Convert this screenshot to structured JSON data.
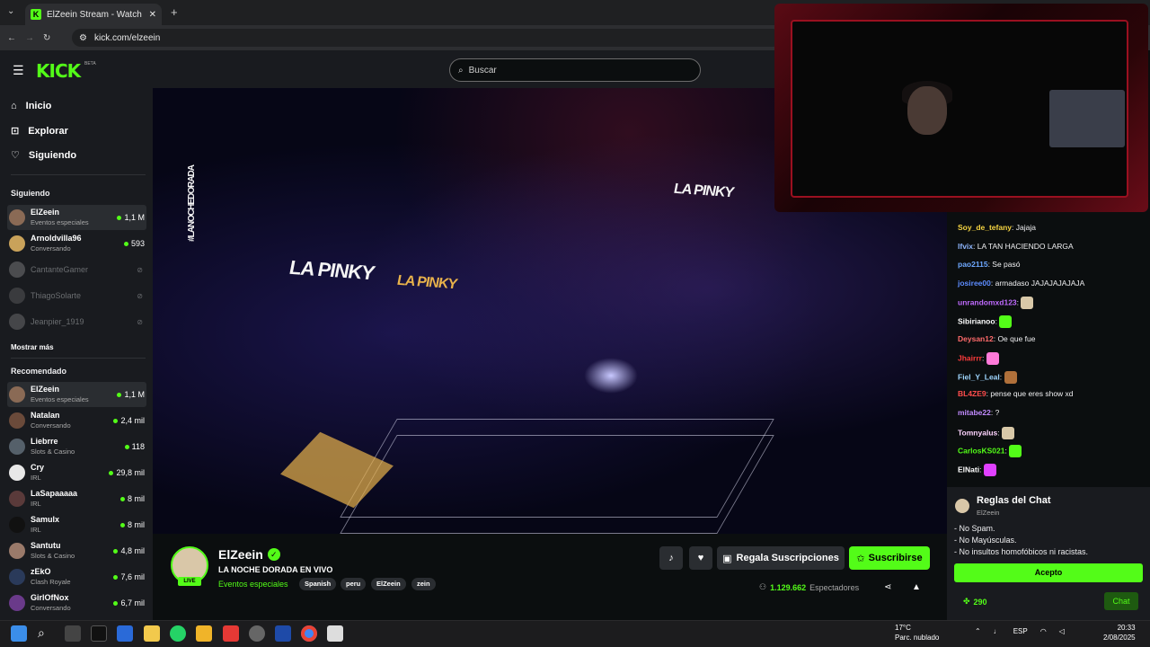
{
  "browser": {
    "tab_title": "ElZeein Stream - Watch Live",
    "url": "kick.com/elzeein"
  },
  "header": {
    "logo": "KICK",
    "beta": "BETA",
    "search_placeholder": "Buscar"
  },
  "sidebar": {
    "nav": [
      {
        "label": "Inicio",
        "icon": "home-icon"
      },
      {
        "label": "Explorar",
        "icon": "compass-icon"
      },
      {
        "label": "Siguiendo",
        "icon": "heart-icon"
      }
    ],
    "following_title": "Siguiendo",
    "following": [
      {
        "name": "ElZeein",
        "category": "Eventos especiales",
        "viewers": "1,1 M",
        "live": true
      },
      {
        "name": "Arnoldvilla96",
        "category": "Conversando",
        "viewers": "593",
        "live": true
      },
      {
        "name": "CantanteGamer",
        "category": "",
        "viewers": "",
        "live": false
      },
      {
        "name": "ThiagoSolarte",
        "category": "",
        "viewers": "",
        "live": false
      },
      {
        "name": "Jeanpier_1919",
        "category": "",
        "viewers": "",
        "live": false
      }
    ],
    "show_more": "Mostrar más",
    "recommended_title": "Recomendado",
    "recommended": [
      {
        "name": "ElZeein",
        "category": "Eventos especiales",
        "viewers": "1,1 M"
      },
      {
        "name": "Natalan",
        "category": "Conversando",
        "viewers": "2,4 mil"
      },
      {
        "name": "Liebrre",
        "category": "Slots & Casino",
        "viewers": "118"
      },
      {
        "name": "Cry",
        "category": "IRL",
        "viewers": "29,8 mil"
      },
      {
        "name": "LaSapaaaaa",
        "category": "IRL",
        "viewers": "8 mil"
      },
      {
        "name": "Samulx",
        "category": "IRL",
        "viewers": "8 mil"
      },
      {
        "name": "Santutu",
        "category": "Slots & Casino",
        "viewers": "4,8 mil"
      },
      {
        "name": "zEkO",
        "category": "Clash Royale",
        "viewers": "7,6 mil"
      },
      {
        "name": "GirlOfNox",
        "category": "Conversando",
        "viewers": "6,7 mil"
      }
    ]
  },
  "video": {
    "signs": [
      "LA PINKY",
      "LA PINKY",
      "LA PINKY",
      "#LANOCHEDORADA"
    ]
  },
  "stream": {
    "name": "ElZeein",
    "live_label": "LIVE",
    "title": "LA NOCHE DORADA EN VIVO",
    "category": "Eventos especiales",
    "tags": [
      "Spanish",
      "peru",
      "ElZeein",
      "zein"
    ],
    "gift_label": "Regala Suscripciones",
    "subscribe_label": "Suscribirse",
    "viewers_count": "1.129.662",
    "viewers_label": "Espectadores"
  },
  "chat": {
    "messages": [
      {
        "user": "Soy_de_tefany",
        "color": "#f5d442",
        "text": "Jajaja"
      },
      {
        "user": "lfvix",
        "color": "#8fb7ff",
        "text": "LA TAN HACIENDO LARGA"
      },
      {
        "user": "pao2115",
        "color": "#6ea8ff",
        "text": "Se pasó"
      },
      {
        "user": "josiree00",
        "color": "#5d8cff",
        "text": "armadaso JAJAJAJAJAJA"
      },
      {
        "user": "unrandomxd123",
        "color": "#c06bff",
        "text": ""
      },
      {
        "user": "Sibirianoo",
        "color": "#ffffff",
        "text": ""
      },
      {
        "user": "Deysan12",
        "color": "#ff6b6b",
        "text": "Oe que fue"
      },
      {
        "user": "Jhairrr",
        "color": "#ff3b3b",
        "text": ""
      },
      {
        "user": "Fiel_Y_Leal",
        "color": "#9fd6ff",
        "text": ""
      },
      {
        "user": "BL4ZE9",
        "color": "#ff4d4d",
        "text": "pense que eres show xd"
      },
      {
        "user": "mitabe22",
        "color": "#c28bff",
        "text": "?"
      },
      {
        "user": "Tomnyalus",
        "color": "#ffd4ff",
        "text": ""
      },
      {
        "user": "CarlosKS021",
        "color": "#53fc18",
        "text": ""
      },
      {
        "user": "ElNati",
        "color": "#ffffff",
        "text": ""
      }
    ],
    "rules_title": "Reglas del Chat",
    "rules_owner": "ElZeein",
    "rules": [
      "- No Spam.",
      "- No Mayúsculas.",
      "- No insultos homofóbicos ni racistas."
    ],
    "accept_label": "Acepto",
    "points": "290",
    "chat_button": "Chat"
  },
  "taskbar": {
    "temperature": "17°C",
    "weather": "Parc. nublado",
    "language": "ESP",
    "time": "20:33",
    "date": "2/08/2025"
  },
  "colors": {
    "brand": "#53fc18",
    "surface": "#191b1f",
    "background": "#0b0e0f"
  }
}
